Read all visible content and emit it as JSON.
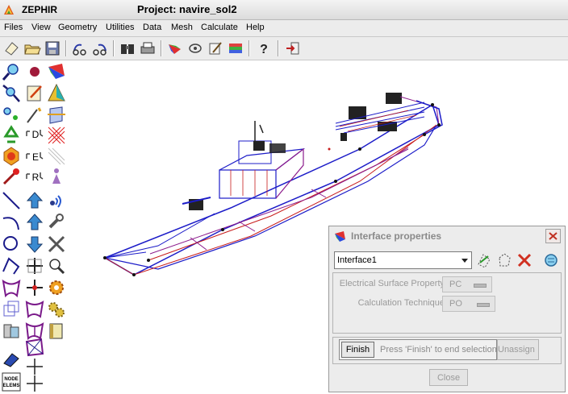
{
  "app": {
    "name": "ZEPHIR",
    "project_title": "Project: navire_sol2"
  },
  "menu": [
    "Files",
    "View",
    "Geometry",
    "Utilities",
    "Data",
    "Mesh",
    "Calculate",
    "Help"
  ],
  "toolbar": {
    "icons": [
      "new-file-icon",
      "open-folder-icon",
      "save-disk-icon",
      "undo-arrow-icon",
      "redo-arrow-icon",
      "binoculars-icon",
      "print-icon",
      "colormap-icon",
      "view-icon",
      "edit-icon",
      "layers-icon",
      "help-icon",
      "exit-icon"
    ]
  },
  "palette": {
    "labels": {
      "d": "D",
      "e": "E",
      "r": "R",
      "nodes": "NODE",
      "elems": "ELEMS"
    }
  },
  "dialog": {
    "title": "Interface properties",
    "interface_value": "Interface1",
    "electrical_label": "Electrical Surface Property",
    "electrical_value": "PC",
    "technique_label": "Calculation Technique",
    "technique_value": "PO",
    "finish_label": "Finish",
    "finish_hint": "Press 'Finish' to end selection",
    "unassign_label": "Unassign",
    "close_label": "Close"
  },
  "colors": {
    "mesh_blue": "#1c1cc8",
    "mesh_red": "#c81c1c",
    "mesh_magenta": "#8c1c8c"
  }
}
